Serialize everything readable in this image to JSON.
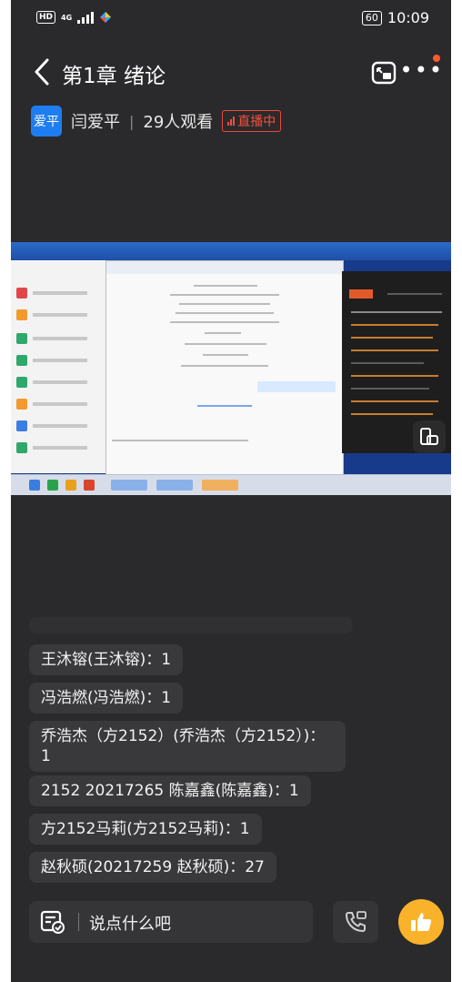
{
  "status_bar": {
    "hd_label": "HD",
    "network_label": "4G",
    "battery": "60",
    "time": "10:09"
  },
  "header": {
    "title": "第1章 绪论",
    "back_icon": "chevron-left-icon",
    "cast_icon": "screen-cast-icon",
    "more_icon": "more-icon",
    "notify_color": "#ff5a2d"
  },
  "host": {
    "avatar_text": "爱平",
    "name": "闫爱平",
    "viewers": "29人观看",
    "live_label": "直播中",
    "avatar_color": "#1e7df0",
    "live_color": "#f0503c"
  },
  "comments": [
    {
      "text": "王沐镕(王沐镕)：1"
    },
    {
      "text": "冯浩燃(冯浩燃)：1"
    },
    {
      "text": "乔浩杰（方2152）(乔浩杰（方2152）)：1"
    },
    {
      "text": "2152  20217265  陈嘉鑫(陈嘉鑫)：1"
    },
    {
      "text": "方2152马莉(方2152马莉)：1"
    },
    {
      "text": "赵秋硕(20217259 赵秋硕)：27"
    }
  ],
  "bottom_bar": {
    "input_placeholder": "说点什么吧",
    "edit_icon": "comment-edit-icon",
    "call_icon": "call-icon",
    "like_icon": "thumbs-up-icon",
    "like_color": "#f9b22a"
  }
}
